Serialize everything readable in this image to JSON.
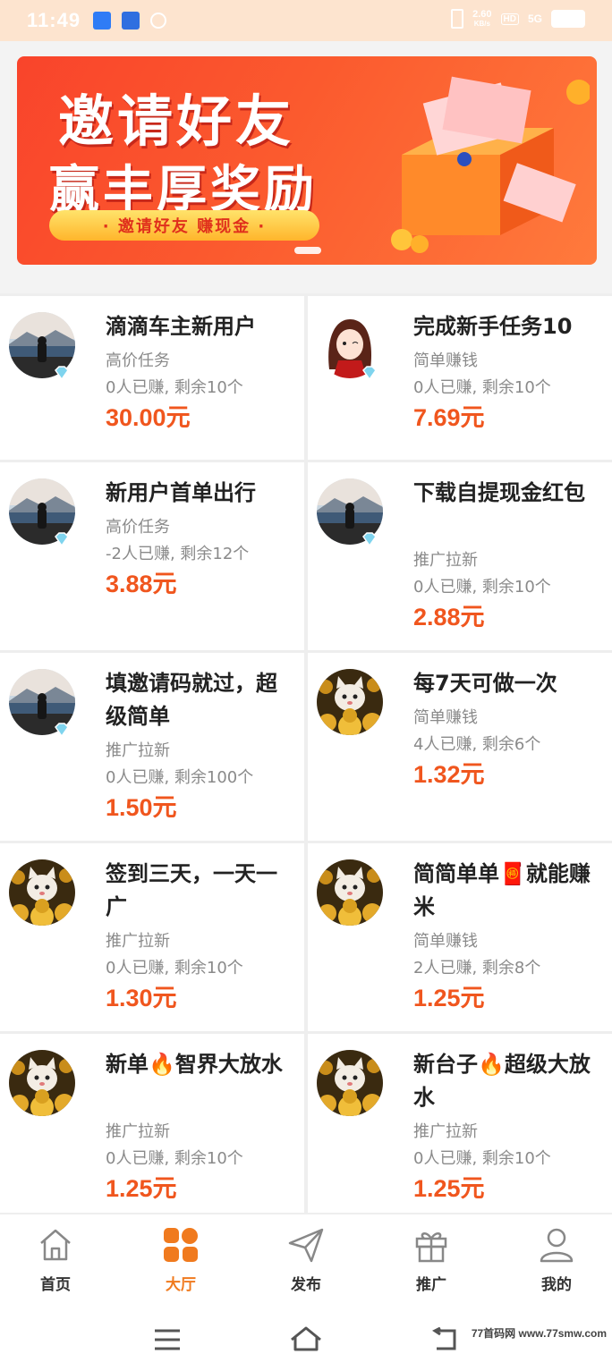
{
  "status_bar": {
    "time": "11:49",
    "net_speed": "2.60",
    "net_unit": "KB/s",
    "hd": "HD",
    "signal": "5G"
  },
  "banner": {
    "title_line1": "邀请好友",
    "title_line2": "赢丰厚奖励",
    "pill_text": "· 邀请好友  赚现金 ·"
  },
  "tasks": [
    {
      "title": "滴滴车主新用户",
      "category": "高价任务",
      "stats": "0人已赚, 剩余10个",
      "price": "30.00元",
      "avatar": "lake-photo-avatar"
    },
    {
      "title": "完成新手任务10",
      "category": "简单赚钱",
      "stats": "0人已赚, 剩余10个",
      "price": "7.69元",
      "avatar": "anime-girl-avatar"
    },
    {
      "title": "新用户首单出行",
      "category": "高价任务",
      "stats": "-2人已赚, 剩余12个",
      "price": "3.88元",
      "avatar": "lake-photo-avatar"
    },
    {
      "title": "下载自提现金红包",
      "category": "推广拉新",
      "stats": "0人已赚, 剩余10个",
      "price": "2.88元",
      "avatar": "lake-photo-avatar"
    },
    {
      "title": "填邀请码就过，超级简单",
      "category": "推广拉新",
      "stats": "0人已赚, 剩余100个",
      "price": "1.50元",
      "avatar": "lake-photo-avatar"
    },
    {
      "title": "每7天可做一次",
      "category": "简单赚钱",
      "stats": "4人已赚, 剩余6个",
      "price": "1.32元",
      "avatar": "fortune-cat-avatar"
    },
    {
      "title": "签到三天，一天一广",
      "category": "推广拉新",
      "stats": "0人已赚, 剩余10个",
      "price": "1.30元",
      "avatar": "fortune-cat-avatar"
    },
    {
      "title": "简简单单🧧就能赚米",
      "category": "简单赚钱",
      "stats": "2人已赚, 剩余8个",
      "price": "1.25元",
      "avatar": "fortune-cat-avatar"
    },
    {
      "title": "新单🔥智界大放水",
      "category": "推广拉新",
      "stats": "0人已赚, 剩余10个",
      "price": "1.25元",
      "avatar": "fortune-cat-avatar"
    },
    {
      "title": "新台子🔥超级大放水",
      "category": "推广拉新",
      "stats": "0人已赚, 剩余10个",
      "price": "1.25元",
      "avatar": "fortune-cat-avatar"
    }
  ],
  "nav": {
    "items": [
      {
        "label": "首页",
        "icon": "home-icon"
      },
      {
        "label": "大厅",
        "icon": "grid-icon",
        "active": true
      },
      {
        "label": "发布",
        "icon": "paper-plane-icon"
      },
      {
        "label": "推广",
        "icon": "gift-icon"
      },
      {
        "label": "我的",
        "icon": "user-icon"
      }
    ]
  },
  "watermark": "77首码网  www.77smw.com",
  "colors": {
    "accent": "#f07a1e",
    "price": "#f0561e",
    "status_bar": "#fde4cf",
    "banner": "#f9442b"
  }
}
